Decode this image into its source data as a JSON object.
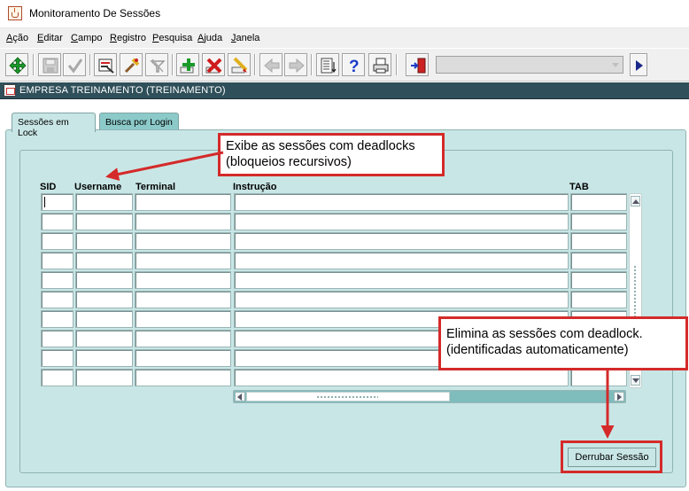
{
  "window": {
    "title": "Monitoramento De Sessões",
    "icon": "java-cup-icon"
  },
  "menu": [
    {
      "pre": "",
      "ul": "A",
      "post": "ção"
    },
    {
      "pre": "",
      "ul": "E",
      "post": "ditar"
    },
    {
      "pre": "",
      "ul": "C",
      "post": "ampo"
    },
    {
      "pre": "",
      "ul": "R",
      "post": "egistro"
    },
    {
      "pre": "",
      "ul": "P",
      "post": "esquisa"
    },
    {
      "pre": "",
      "ul": "A",
      "post": "juda"
    },
    {
      "pre": "",
      "ul": "J",
      "post": "anela"
    }
  ],
  "toolbar": {
    "buttons": [
      "move-icon",
      "save-icon",
      "accept-icon",
      "print-icon",
      "search-icon",
      "filter-icon",
      "insert-record-icon",
      "delete-record-icon",
      "clear-icon",
      "previous-icon",
      "next-icon",
      "list-icon",
      "help-icon",
      "printer-icon",
      "exit-icon",
      "play-icon"
    ]
  },
  "header": {
    "title": "EMPRESA TREINAMENTO (TREINAMENTO)"
  },
  "tabs": [
    {
      "label": "Sessões em Lock",
      "active": true
    },
    {
      "label": "Busca por Login",
      "active": false
    }
  ],
  "table": {
    "columns": [
      "SID",
      "Username",
      "Terminal",
      "Instrução",
      "TAB"
    ],
    "row_count": 10
  },
  "actions": {
    "kill_label": "Derrubar Sessão"
  },
  "annotations": {
    "deadlock_line1": "Exibe as sessões com deadlocks",
    "deadlock_line2": "(bloqueios recursivos)",
    "kill_line1": "Elimina as sessões com deadlock.",
    "kill_line2": "(identificadas automaticamente)"
  },
  "colors": {
    "canvas": "#c9e6e6",
    "header": "#2f4f5a",
    "callout_border": "#d42a2a"
  }
}
